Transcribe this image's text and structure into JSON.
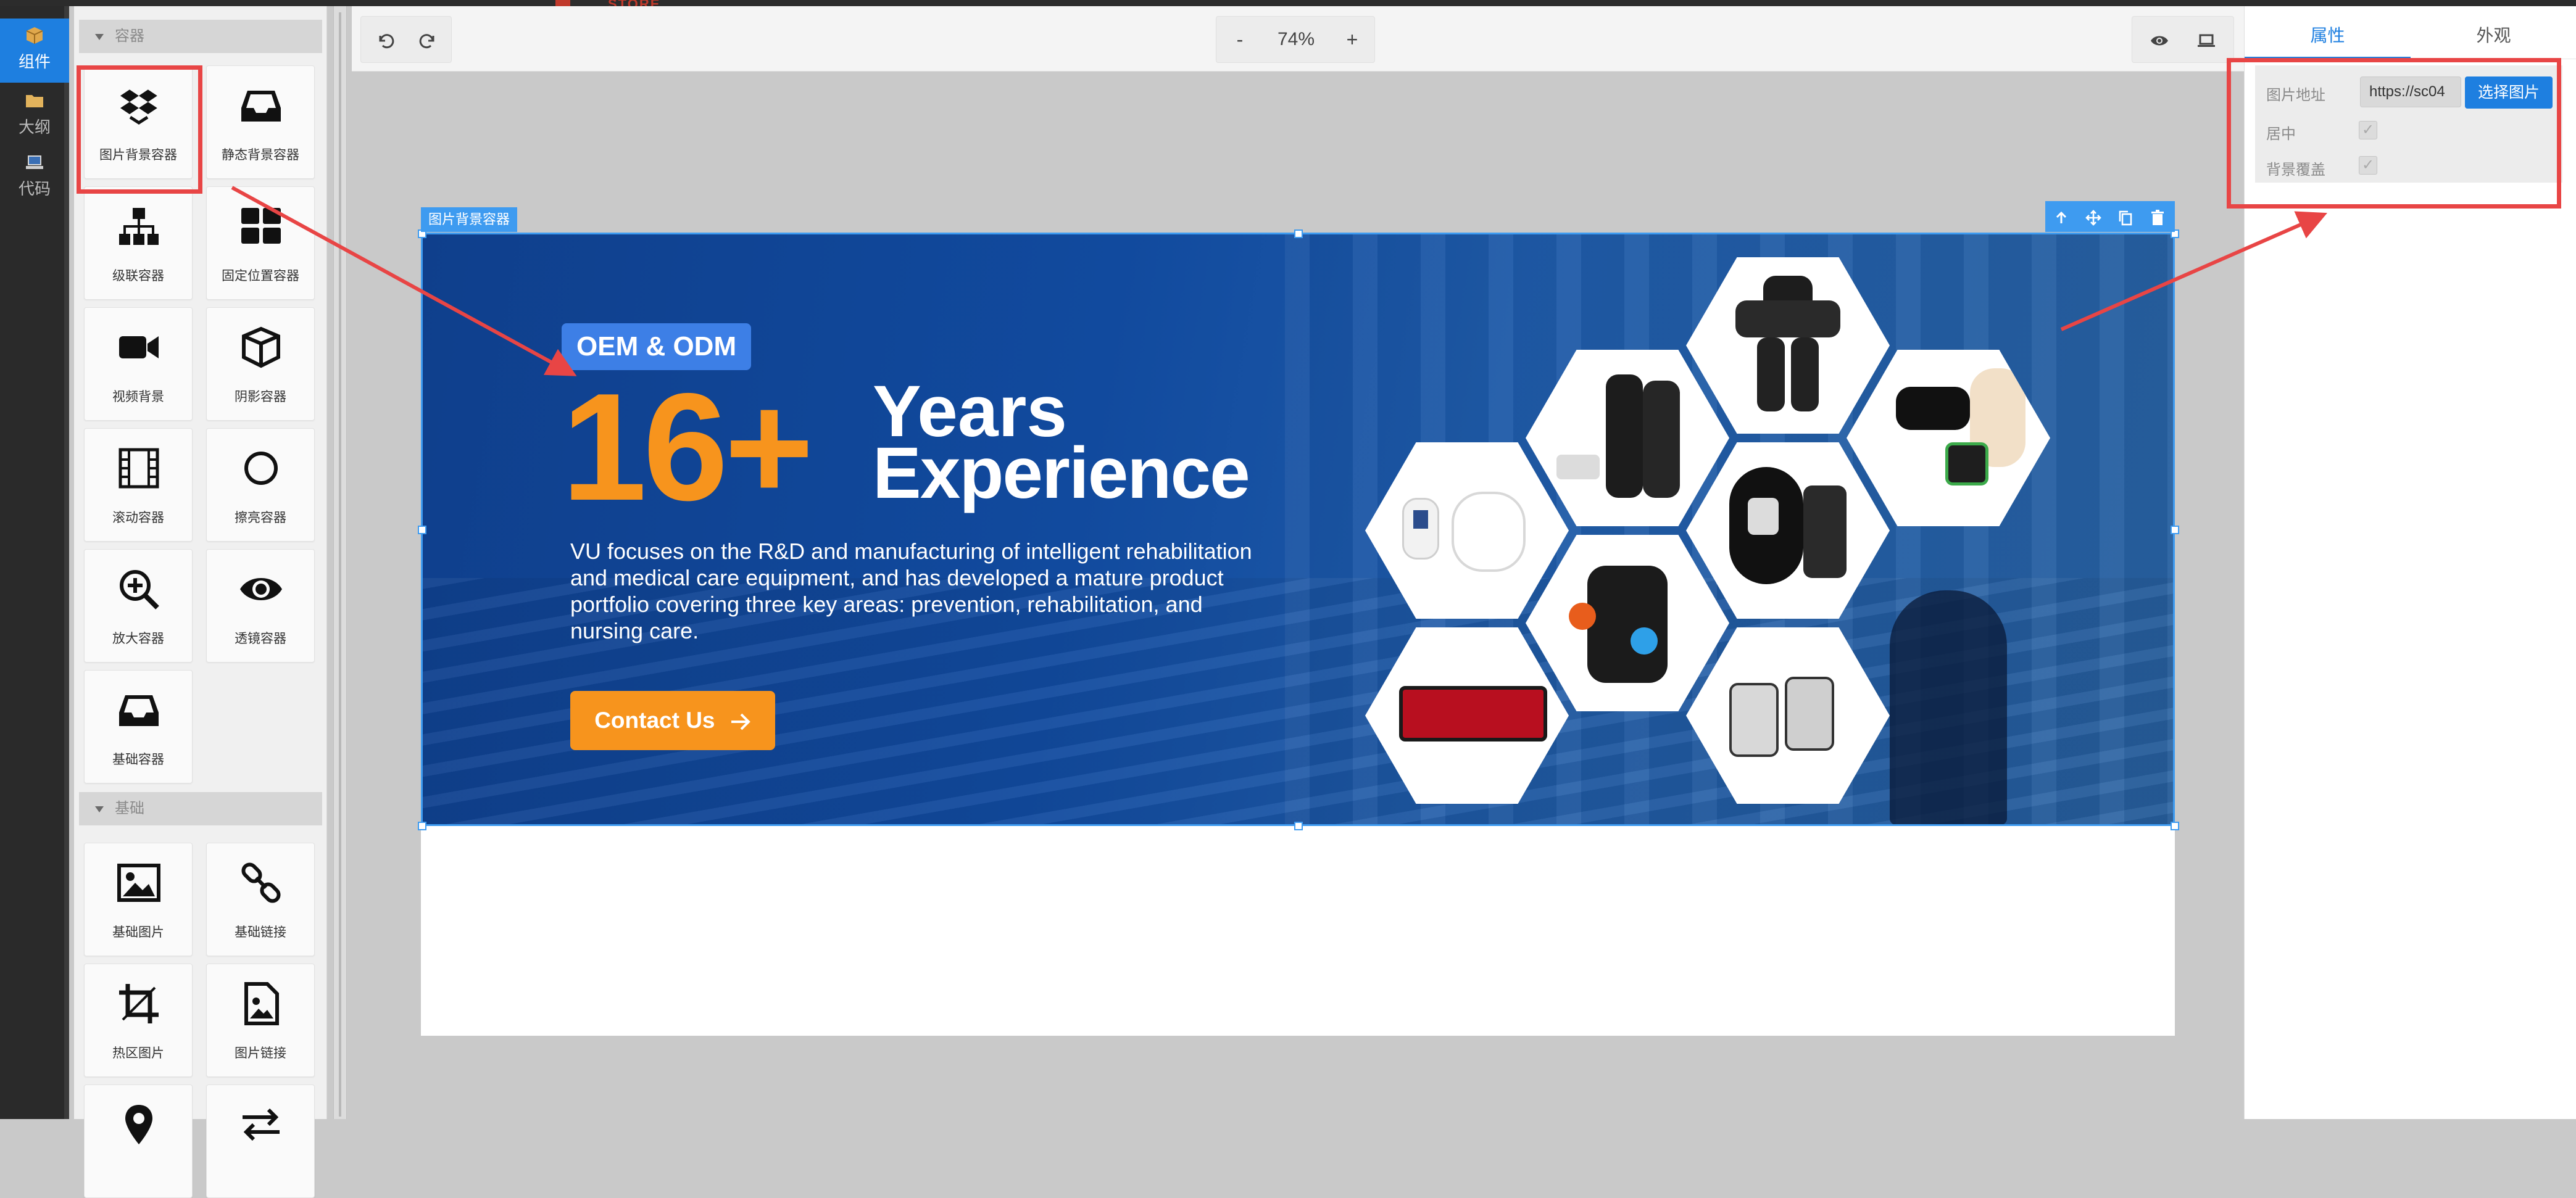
{
  "top_strip": {
    "store_text": "STORE"
  },
  "rail": {
    "items": [
      {
        "label": "组件",
        "icon": "box-icon",
        "active": true
      },
      {
        "label": "大纲",
        "icon": "folder-icon",
        "active": false
      },
      {
        "label": "代码",
        "icon": "laptop-icon",
        "active": false
      }
    ]
  },
  "palette": {
    "groups": [
      {
        "title": "容器",
        "items": [
          {
            "label": "图片背景容器",
            "icon": "dropbox-icon"
          },
          {
            "label": "静态背景容器",
            "icon": "inbox-icon"
          },
          {
            "label": "级联容器",
            "icon": "sitemap-icon"
          },
          {
            "label": "固定位置容器",
            "icon": "grid-icon"
          },
          {
            "label": "视频背景",
            "icon": "video-camera-icon"
          },
          {
            "label": "阴影容器",
            "icon": "cube-icon"
          },
          {
            "label": "滚动容器",
            "icon": "film-icon"
          },
          {
            "label": "擦亮容器",
            "icon": "circle-icon"
          },
          {
            "label": "放大容器",
            "icon": "zoom-in-icon"
          },
          {
            "label": "透镜容器",
            "icon": "eye-icon"
          },
          {
            "label": "基础容器",
            "icon": "inbox-icon"
          }
        ]
      },
      {
        "title": "基础",
        "items": [
          {
            "label": "基础图片",
            "icon": "image-icon"
          },
          {
            "label": "基础链接",
            "icon": "link-icon"
          },
          {
            "label": "热区图片",
            "icon": "crop-icon"
          },
          {
            "label": "图片链接",
            "icon": "image-file-icon"
          },
          {
            "label": "",
            "icon": "map-pin-icon"
          },
          {
            "label": "",
            "icon": "arrows-left-right-icon"
          }
        ]
      }
    ]
  },
  "toolbar": {
    "undo_icon": "undo-icon",
    "redo_icon": "redo-icon",
    "zoom_out": "-",
    "zoom_level": "74%",
    "zoom_in": "+",
    "preview_icon": "eye-icon",
    "device_icon": "laptop-icon"
  },
  "selection": {
    "tag": "图片背景容器",
    "actions": [
      "arrow-up-icon",
      "move-icon",
      "copy-icon",
      "trash-icon"
    ]
  },
  "banner": {
    "badge": "OEM & ODM",
    "big_number": "16+",
    "line1": "Years",
    "line2": "Experience",
    "description": "VU focuses on the R&D and manufacturing of intelligent rehabilitation and medical care equipment, and has developed a mature product portfolio covering three key areas: prevention, rehabilitation, and nursing care.",
    "cta_label": "Contact Us",
    "cta_icon": "arrow-right-icon",
    "colors": {
      "accent": "#f7941d",
      "badge": "#3d7fe6",
      "bg": "#114a9e"
    }
  },
  "right_panel": {
    "tabs": [
      {
        "label": "属性",
        "active": true
      },
      {
        "label": "外观",
        "active": false
      }
    ],
    "props": {
      "image_url_label": "图片地址",
      "image_url_value": "https://sc04",
      "choose_button": "选择图片",
      "center_label": "居中",
      "center_checked": true,
      "cover_label": "背景覆盖",
      "cover_checked": true
    }
  },
  "colors": {
    "primary": "#1e7fe0",
    "selection": "#3e9bf0",
    "annotation": "#e84545"
  }
}
